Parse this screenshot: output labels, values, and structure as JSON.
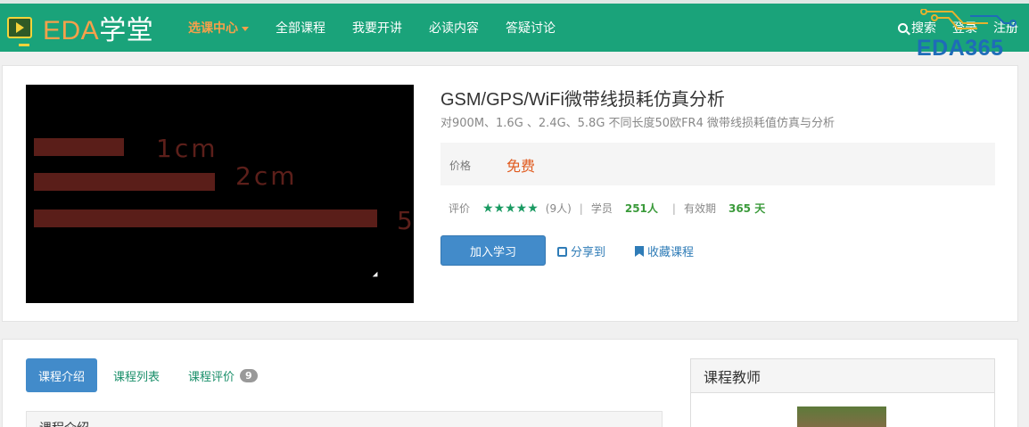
{
  "brand": {
    "prefix": "EDA",
    "suffix": "学堂"
  },
  "nav": {
    "items": [
      {
        "label": "选课中心",
        "active": true,
        "dropdown": true
      },
      {
        "label": "全部课程"
      },
      {
        "label": "我要开讲"
      },
      {
        "label": "必读内容"
      },
      {
        "label": "答疑讨论"
      }
    ],
    "search_label": "搜索",
    "login_label": "登录",
    "register_label": "注册"
  },
  "watermark": "EDA365",
  "course": {
    "title": "GSM/GPS/WiFi微带线损耗仿真分析",
    "subtitle": "对900M、1.6G 、2.4G、5.8G 不同长度50欧FR4 微带线损耗值仿真与分析",
    "price_label": "价格",
    "price_value": "免费",
    "rating_label": "评价",
    "rating_stars": 5,
    "rating_count": "(9人)",
    "students_label": "学员",
    "students_value": "251人",
    "validity_label": "有效期",
    "validity_value": "365 天",
    "join_label": "加入学习",
    "share_label": "分享到",
    "favorite_label": "收藏课程"
  },
  "video": {
    "labels": [
      "1cm",
      "2cm",
      "5"
    ],
    "bar_lengths_cm": [
      1,
      2,
      5
    ]
  },
  "tabs": [
    {
      "label": "课程介绍",
      "active": true
    },
    {
      "label": "课程列表"
    },
    {
      "label": "课程评价",
      "badge": "9"
    }
  ],
  "intro_title": "课程介绍",
  "teacher_title": "课程教师",
  "colors": {
    "nav_bg": "#1aa37a",
    "accent_orange": "#f7a04a",
    "primary_button": "#428bca",
    "price": "#e05a1e",
    "star": "#1a9a62"
  }
}
